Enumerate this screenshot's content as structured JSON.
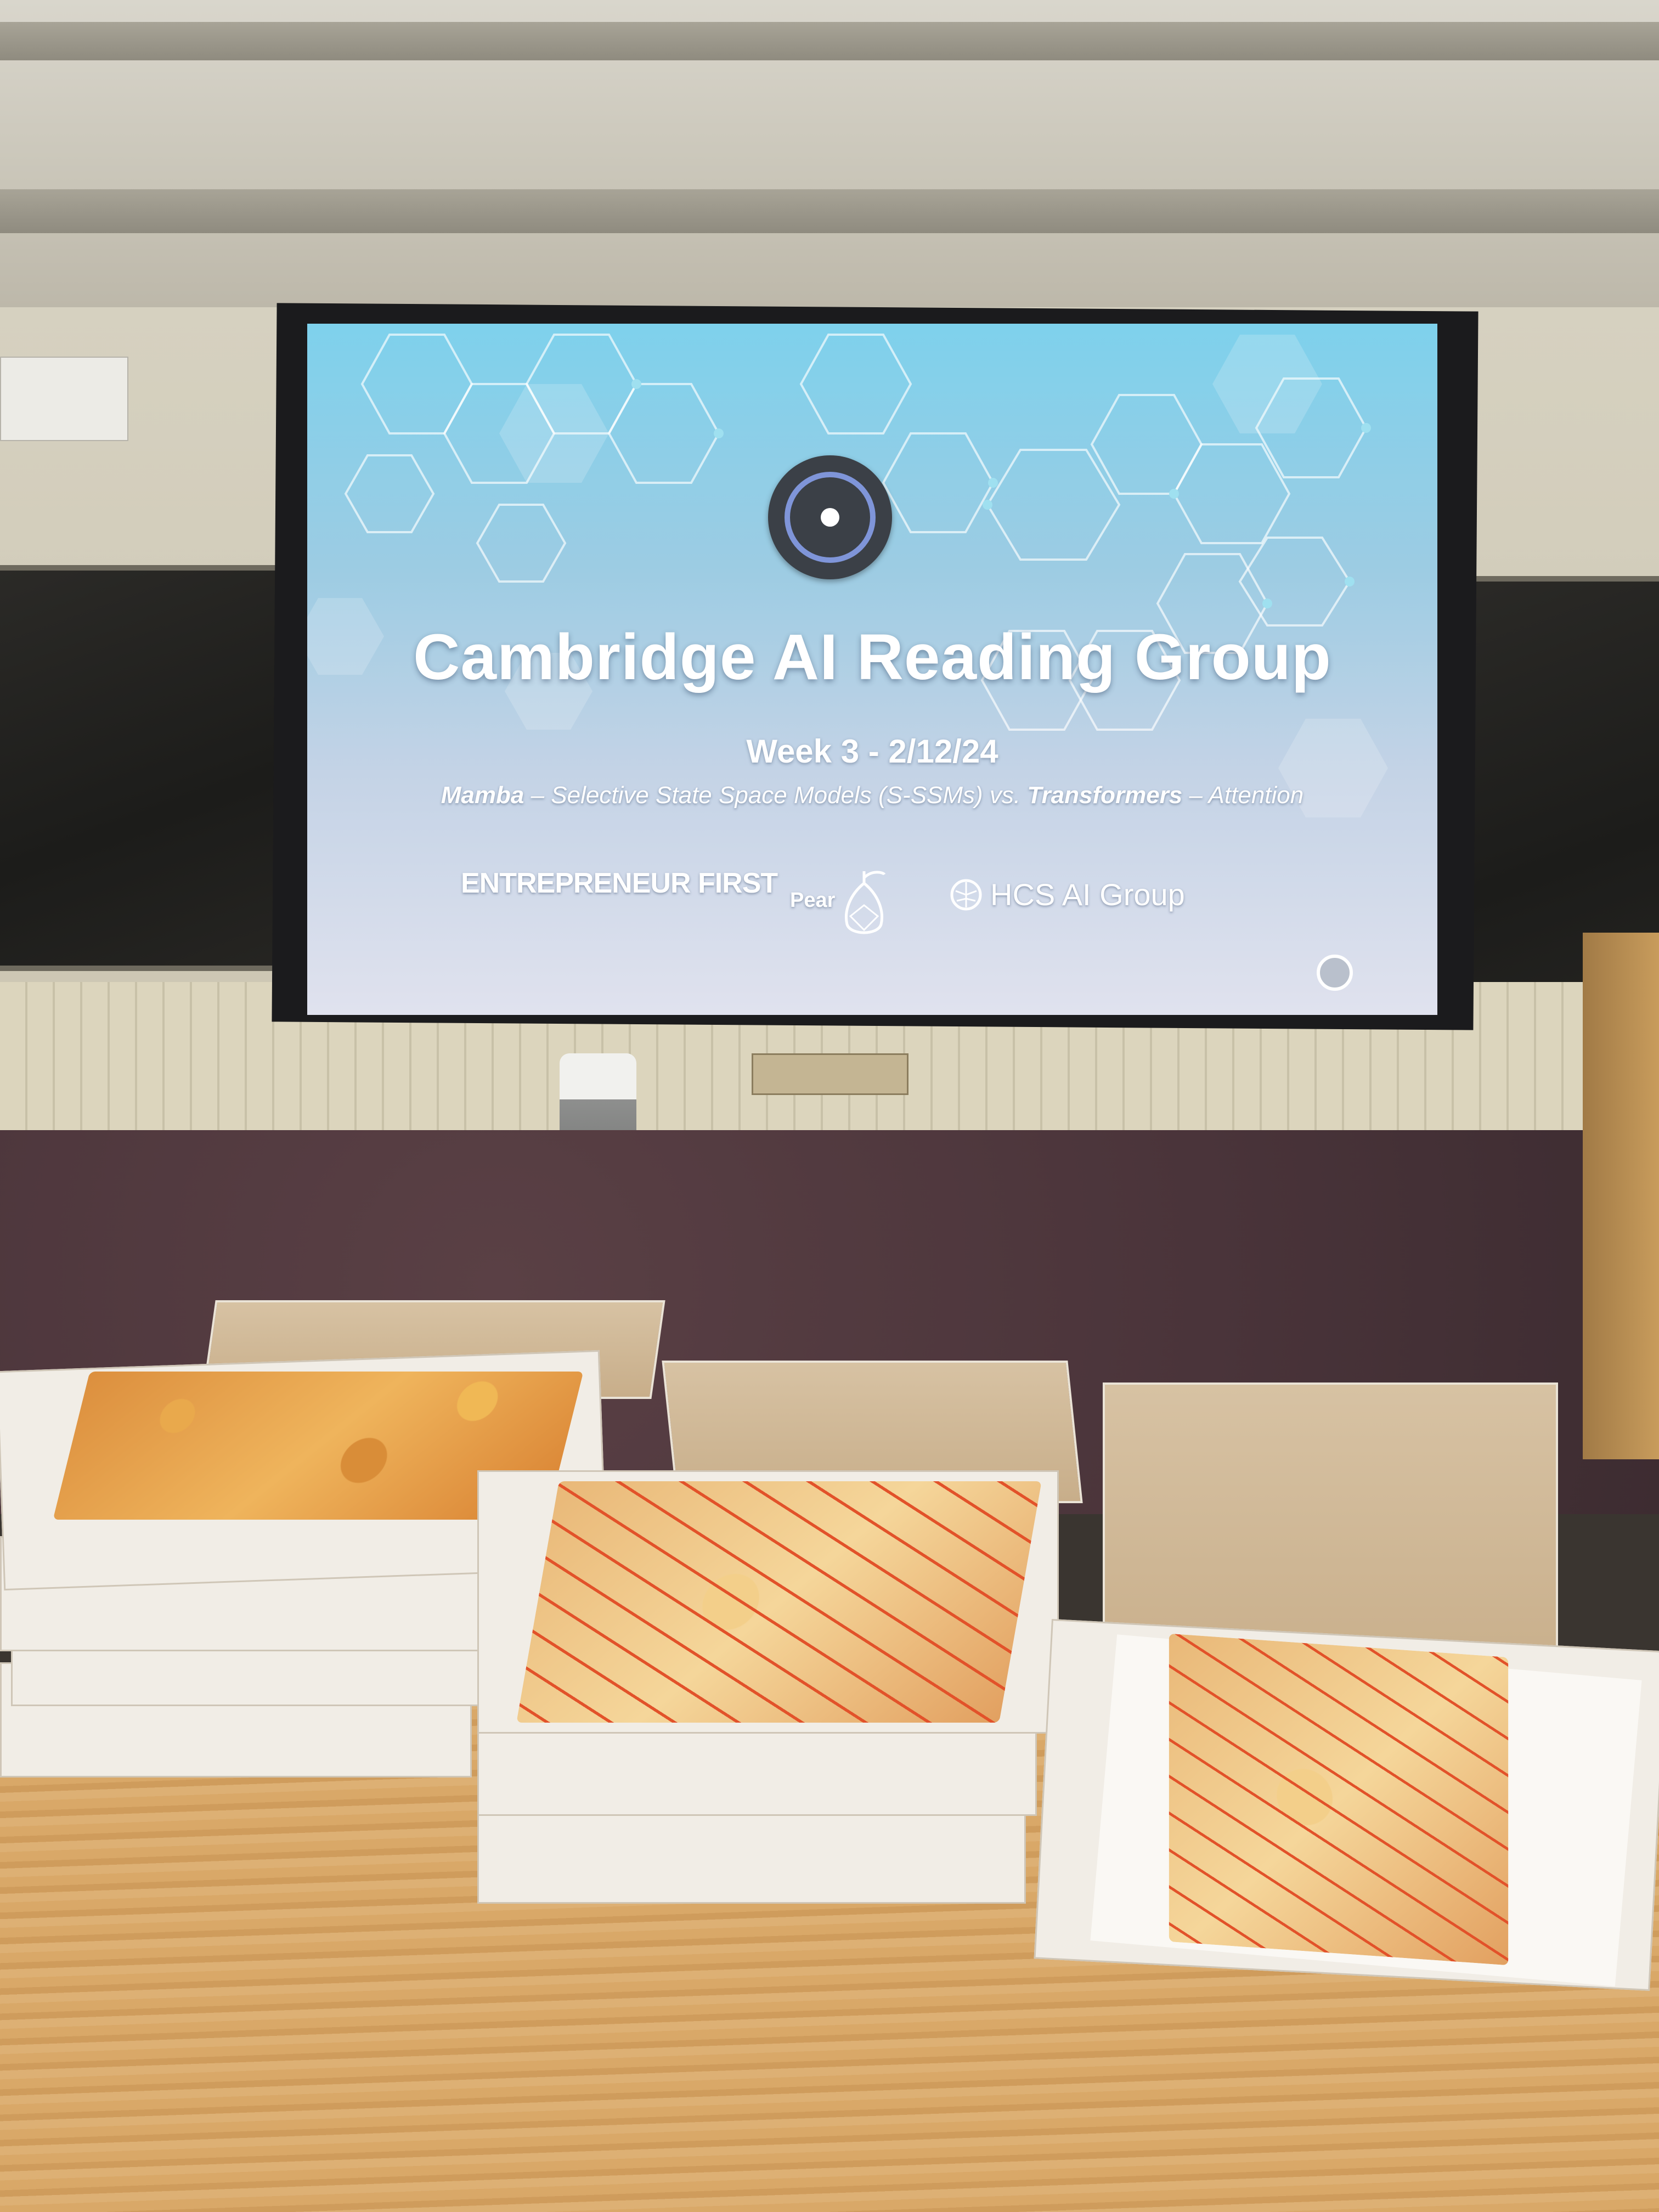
{
  "slide": {
    "title": "Cambridge AI Reading Group",
    "week": "Week 3 - 2/12/24",
    "subtitle_part1_bold": "Mamba",
    "subtitle_part2": " – Selective State Space Models (S-SSMs) vs. ",
    "subtitle_part3_bold": "Transformers",
    "subtitle_part4": " – Attention",
    "sponsors": {
      "entrepreneur_first": "ENTREPRENEUR FIRST",
      "pear": "Pear",
      "hcs": "HCS AI Group"
    },
    "icons": [
      "cambridge-ai-logo-icon",
      "pear-logo-icon",
      "brain-icon",
      "corner-logo-icon"
    ]
  },
  "colors": {
    "slide_top": "#7ed1ec",
    "slide_bottom": "#e0e2ee",
    "logo_accent": "#7f95d9",
    "table": "#d9a868",
    "carpet": "#4a343a"
  }
}
